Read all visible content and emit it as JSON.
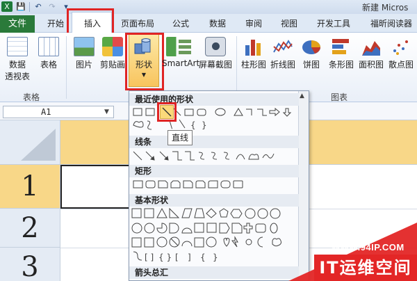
{
  "titlebar": {
    "title": "新建 Micros"
  },
  "tabs": {
    "file": "文件",
    "items": [
      "开始",
      "插入",
      "页面布局",
      "公式",
      "数据",
      "审阅",
      "视图",
      "开发工具",
      "福昕阅读器"
    ]
  },
  "ribbon": {
    "buttons": {
      "pivot_line1": "数据",
      "pivot_line2": "透视表",
      "table": "表格",
      "picture": "图片",
      "clipart": "剪贴画",
      "shapes": "形状",
      "smartart": "SmartArt",
      "screenshot": "屏幕截图",
      "column": "柱形图",
      "line": "折线图",
      "pie": "饼图",
      "bar": "条形图",
      "area": "面积图",
      "scatter": "散点图"
    },
    "groups": {
      "tables": "表格",
      "charts": "图表"
    }
  },
  "namebox": {
    "value": "A1"
  },
  "sheet": {
    "rows": [
      "1",
      "2",
      "3"
    ]
  },
  "shapes_menu": {
    "sections": [
      "最近使用的形状",
      "线条",
      "矩形",
      "基本形状",
      "箭头总汇"
    ],
    "tooltip": "直线"
  },
  "watermark": {
    "url": "WWW.94IP.COM",
    "brand": "IT运维空间"
  },
  "colors": {
    "file_tab": "#2a7a3a",
    "highlight": "#e02424",
    "selection": "#f8d788"
  }
}
